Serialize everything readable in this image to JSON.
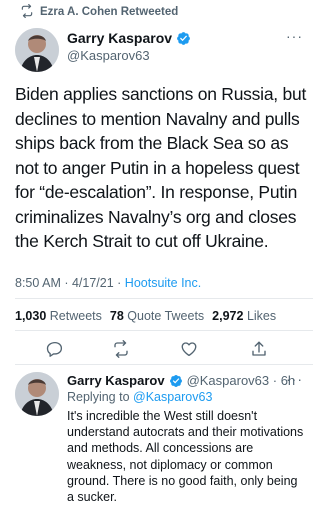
{
  "retweet_banner": {
    "icon": "retweet-icon",
    "text": "Ezra A. Cohen Retweeted"
  },
  "main_tweet": {
    "author_name": "Garry Kasparov",
    "verified": true,
    "handle": "@Kasparov63",
    "body": "Biden applies sanctions on Russia, but declines to mention Navalny and pulls ships back from the Black Sea so as not to anger Putin in a hopeless quest for “de-escalation”. In response, Putin criminalizes Navalny’s org and closes the Kerch Strait to cut off Ukraine.",
    "time": "8:50 AM · 4/17/21 · ",
    "source_app": "Hootsuite Inc.",
    "stats": {
      "retweets_count": "1,030",
      "retweets_label": "Retweets",
      "quotes_count": "78",
      "quotes_label": "Quote Tweets",
      "likes_count": "2,972",
      "likes_label": "Likes"
    },
    "more_icon": "more-icon"
  },
  "actions": [
    "reply-icon",
    "retweet-icon",
    "like-icon",
    "share-icon"
  ],
  "reply_tweet": {
    "author_name": "Garry Kasparov",
    "verified": true,
    "handle_time": "@Kasparov63 · 6h",
    "replying_prefix": "Replying to ",
    "replying_to": "@Kasparov63",
    "body": "It's incredible the West still doesn't understand autocrats and their motivations and methods. All concessions are weakness, not diplomacy or common ground. There is no good faith, only being a sucker."
  },
  "colors": {
    "accent": "#1d9bf0",
    "muted": "#536471",
    "text": "#0f1419"
  }
}
